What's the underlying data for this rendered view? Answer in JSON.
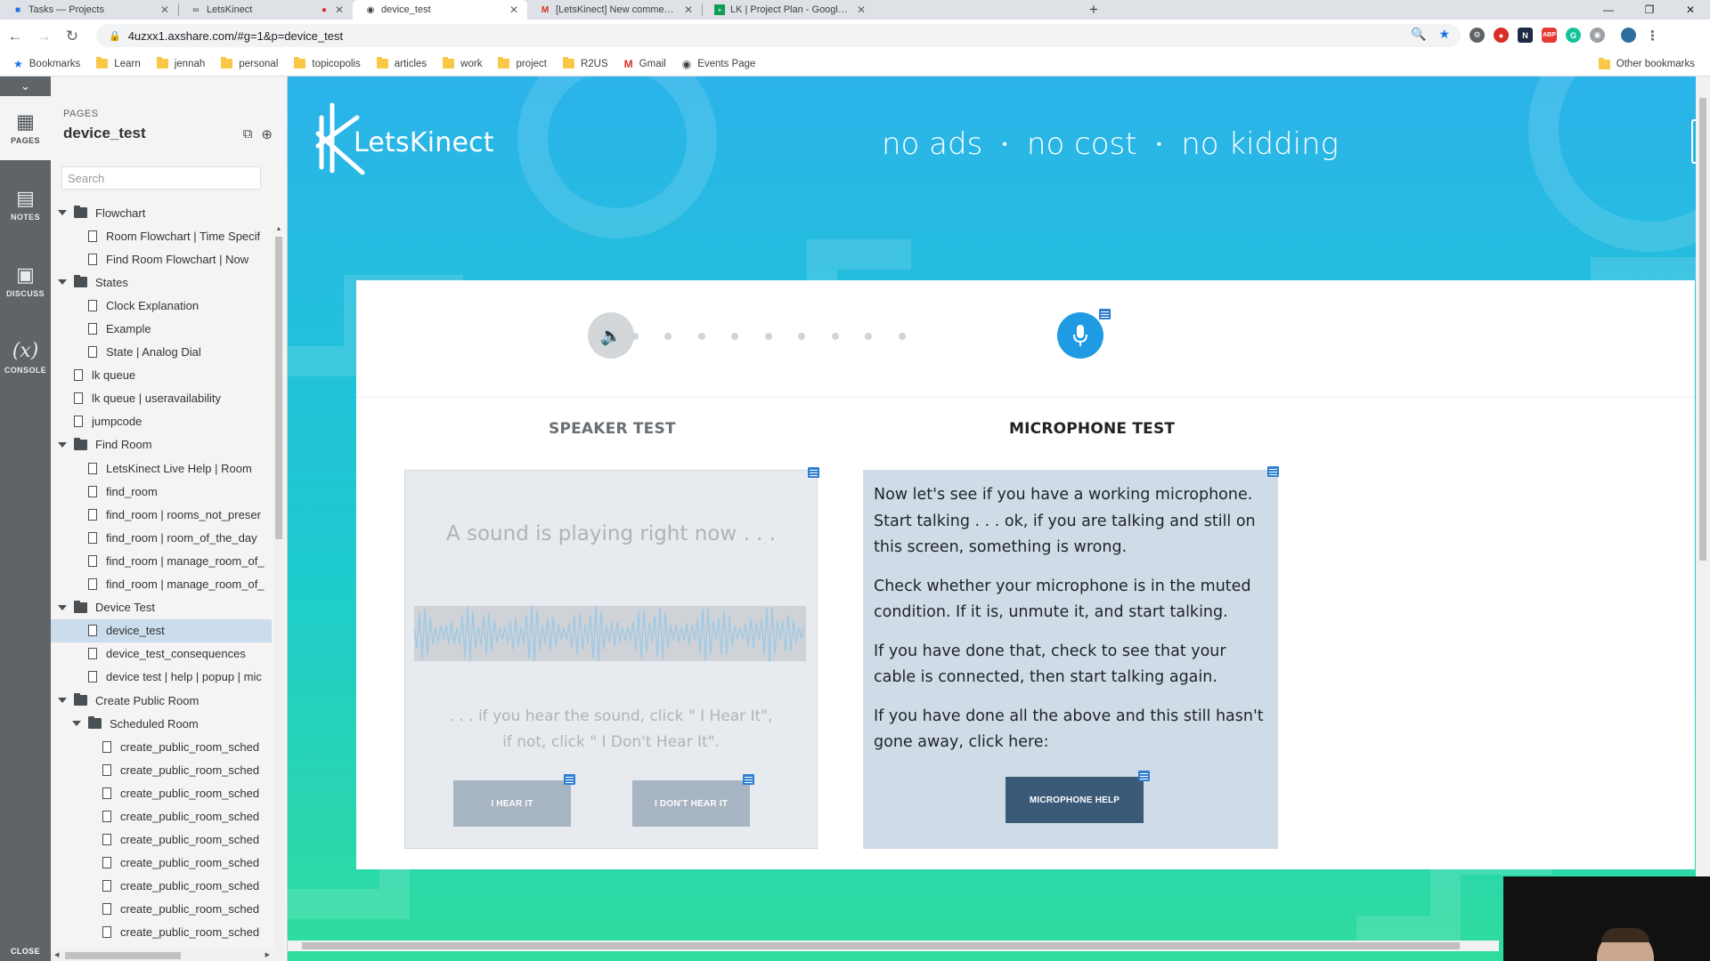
{
  "browser": {
    "tabs": [
      {
        "title": "Tasks — Projects",
        "favicon": "tasks-icon",
        "active": false
      },
      {
        "title": "LetsKinect",
        "favicon": "link-icon",
        "active": false
      },
      {
        "title": "device_test",
        "favicon": "globe-icon",
        "active": true
      },
      {
        "title": "[LetsKinect] New comment on 'S",
        "favicon": "gmail-icon",
        "active": false
      },
      {
        "title": "LK | Project Plan - Google Sheets",
        "favicon": "sheets-icon",
        "active": false
      }
    ],
    "url": "4uzxx1.axshare.com/#g=1&p=device_test",
    "bookmarks": [
      {
        "label": "Bookmarks",
        "icon": "star-icon"
      },
      {
        "label": "Learn",
        "icon": "folder-icon"
      },
      {
        "label": "jennah",
        "icon": "folder-icon"
      },
      {
        "label": "personal",
        "icon": "folder-icon"
      },
      {
        "label": "topicopolis",
        "icon": "folder-icon"
      },
      {
        "label": "articles",
        "icon": "folder-icon"
      },
      {
        "label": "work",
        "icon": "folder-icon"
      },
      {
        "label": "project",
        "icon": "folder-icon"
      },
      {
        "label": "R2US",
        "icon": "folder-icon"
      },
      {
        "label": "Gmail",
        "icon": "gmail-icon"
      },
      {
        "label": "Events Page",
        "icon": "globe-icon"
      }
    ],
    "other_bookmarks": "Other bookmarks"
  },
  "axure": {
    "rail": [
      {
        "label": "PAGES",
        "icon": "sitemap-icon",
        "active": true
      },
      {
        "label": "NOTES",
        "icon": "notes-icon",
        "active": false
      },
      {
        "label": "DISCUSS",
        "icon": "discuss-icon",
        "active": false
      },
      {
        "label": "CONSOLE",
        "icon": "console-icon",
        "active": false
      }
    ],
    "close_label": "CLOSE",
    "pages": {
      "kicker": "PAGES",
      "current": "device_test",
      "search_placeholder": "Search",
      "tree": [
        {
          "label": "Flowchart",
          "type": "folder",
          "level": 0,
          "expanded": true
        },
        {
          "label": "Room Flowchart | Time Specif",
          "type": "page",
          "level": 1
        },
        {
          "label": "Find Room Flowchart | Now",
          "type": "page",
          "level": 1
        },
        {
          "label": "States",
          "type": "folder",
          "level": 0,
          "expanded": true
        },
        {
          "label": "Clock Explanation",
          "type": "page",
          "level": 1
        },
        {
          "label": "Example",
          "type": "page",
          "level": 1
        },
        {
          "label": "State | Analog Dial",
          "type": "page",
          "level": 1
        },
        {
          "label": "lk queue",
          "type": "page",
          "level": 0
        },
        {
          "label": "lk queue | useravailability",
          "type": "page",
          "level": 0
        },
        {
          "label": "jumpcode",
          "type": "page",
          "level": 0
        },
        {
          "label": "Find Room",
          "type": "folder",
          "level": 0,
          "expanded": true
        },
        {
          "label": "LetsKinect Live Help | Room",
          "type": "page",
          "level": 1
        },
        {
          "label": "find_room",
          "type": "page",
          "level": 1
        },
        {
          "label": "find_room | rooms_not_preser",
          "type": "page",
          "level": 1
        },
        {
          "label": "find_room | room_of_the_day",
          "type": "page",
          "level": 1
        },
        {
          "label": "find_room | manage_room_of_",
          "type": "page",
          "level": 1
        },
        {
          "label": "find_room | manage_room_of_",
          "type": "page",
          "level": 1
        },
        {
          "label": "Device Test",
          "type": "folder",
          "level": 0,
          "expanded": true
        },
        {
          "label": "device_test",
          "type": "page",
          "level": 1,
          "selected": true
        },
        {
          "label": "device_test_consequences",
          "type": "page",
          "level": 1
        },
        {
          "label": "device test | help | popup | mic",
          "type": "page",
          "level": 1
        },
        {
          "label": "Create Public Room",
          "type": "folder",
          "level": 0,
          "expanded": true
        },
        {
          "label": "Scheduled Room",
          "type": "folder",
          "level": 1,
          "expanded": true
        },
        {
          "label": "create_public_room_sched",
          "type": "page",
          "level": 2
        },
        {
          "label": "create_public_room_sched",
          "type": "page",
          "level": 2
        },
        {
          "label": "create_public_room_sched",
          "type": "page",
          "level": 2
        },
        {
          "label": "create_public_room_sched",
          "type": "page",
          "level": 2
        },
        {
          "label": "create_public_room_sched",
          "type": "page",
          "level": 2
        },
        {
          "label": "create_public_room_sched",
          "type": "page",
          "level": 2
        },
        {
          "label": "create_public_room_sched",
          "type": "page",
          "level": 2
        },
        {
          "label": "create_public_room_sched",
          "type": "page",
          "level": 2
        },
        {
          "label": "create_public_room_sched",
          "type": "page",
          "level": 2
        }
      ]
    }
  },
  "prototype": {
    "logo_text": "LetsKinect",
    "tagline": [
      "no ads",
      "no cost",
      "no kidding"
    ],
    "tagline_separator": "•",
    "stepper": {
      "start_icon": "speaker-icon",
      "end_icon": "microphone-icon",
      "dot_count": 10
    },
    "speaker": {
      "title": "SPEAKER TEST",
      "playing_text": "A sound is playing right now . . .",
      "instruction_line1": ". . . if you hear the sound, click \" I Hear It\",",
      "instruction_line2": "if not, click \" I Don't Hear It\".",
      "hear_button": "I HEAR IT",
      "dont_hear_button": "I DON'T HEAR IT"
    },
    "microphone": {
      "title": "MICROPHONE TEST",
      "paragraphs": [
        "Now let's see if you have a working microphone. Start talking . . . ok, if you are talking and still on this screen, something is wrong.",
        "Check whether your microphone is in the muted condition. If it is, unmute it, and start talking.",
        "If you have done that, check to see that your cable is connected, then start talking again.",
        "If you have done all the above and this still hasn't gone away, click here:"
      ],
      "help_button": "MICROPHONE HELP"
    }
  },
  "colors": {
    "stepper_active": "#1e9be3",
    "mic_panel_bg": "#cfdce7",
    "mic_help_button": "#3b5a78",
    "speaker_button": "#a7b4c1",
    "selected_page_bg": "#cbdcec"
  }
}
